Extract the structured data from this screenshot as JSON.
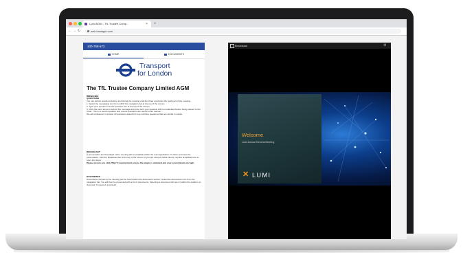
{
  "browser": {
    "tab_title": "Lumi AGM - TfL Trustee Comp...",
    "tab_close": "×",
    "new_tab": "+",
    "back": "←",
    "forward": "→",
    "reload": "↻",
    "url": "web.lumiagm.com"
  },
  "meeting": {
    "id": "100-758-572",
    "tabs": [
      {
        "label": "HOME"
      },
      {
        "label": "DOCUMENTS"
      }
    ],
    "logo": {
      "line1": "Transport",
      "line2": "for London",
      "color": "#1a3d8f"
    },
    "title": "The TfL Trustee Company Limited AGM",
    "welcome_heading": "Welcome",
    "questions_heading": "QUESTIONS",
    "questions_text": "You can submit questions before and during the meeting until the Chair concludes the Q&A part of the meeting.",
    "questions_steps": [
      "1. Select the messaging icon from within the navigation bar at the top of the screen.",
      "2. Type your question into the question box at the top of the screen.",
      "3. Click the send arrow to submit the message and once sent your question will be moderated before being passed to the Chair. This is to avoid repetition and ensure questions are read in a fair manner.",
      "We will endeavour to answer all questions asked but may combine questions that are similar in nature."
    ],
    "broadcast_heading": "BROADCAST",
    "broadcast_text": "A presentation and broadcast of the meeting will be available within the Lumi application. To listen and view the presentation, click the Broadcast bar at the top of the screen. If you are using a mobile device, tap the broadcast icon to open the player.",
    "broadcast_bold": "Please ensure you click 'Play' if required and ensure the player is unmuted and your sound levels are high.",
    "documents_heading": "DOCUMENTS",
    "documents_text": "Documents relevant to the meeting can be found within the documents section. Select the documents icon from the navigation bar. You will then be presented with a list of documents. Selecting a document will open it within the platform to view and, if required, download."
  },
  "broadcast": {
    "title": "Broadcast",
    "welcome": "Welcome",
    "subtitle": "Lumi Annual General Meeting",
    "brand": "LUMI",
    "brand_mark": "✕",
    "accent": "#e8a23b"
  },
  "colors": {
    "meeting_bar": "#2a4d9f",
    "laptop": "#1c1c1e"
  }
}
